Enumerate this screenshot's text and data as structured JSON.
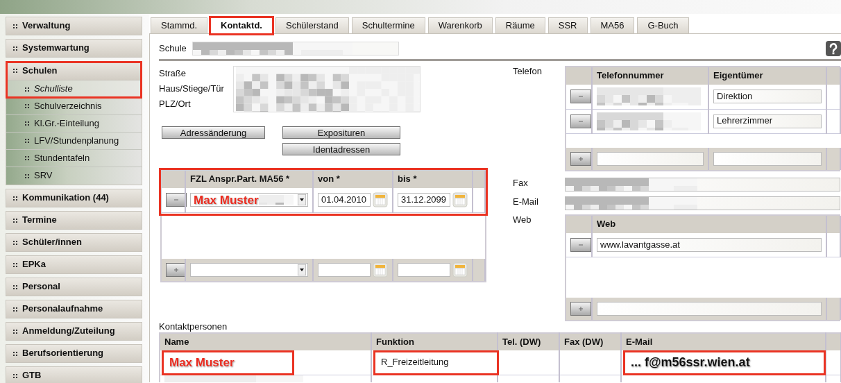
{
  "sidebar": {
    "items": [
      {
        "label": "Verwaltung"
      },
      {
        "label": "Systemwartung"
      },
      {
        "label": "Schulen",
        "highlighted": true,
        "children": [
          {
            "label": "Schulliste",
            "selected": true,
            "highlighted": true
          },
          {
            "label": "Schulverzeichnis",
            "selected": false,
            "highlighted": false
          },
          {
            "label": "Kl.Gr.-Einteilung",
            "selected": false,
            "highlighted": false
          },
          {
            "label": "LFV/Stundenplanung",
            "selected": false,
            "highlighted": false
          },
          {
            "label": "Stundentafeln",
            "selected": false,
            "highlighted": false
          },
          {
            "label": "SRV",
            "selected": false,
            "highlighted": false
          }
        ]
      },
      {
        "label": "Kommunikation (44)"
      },
      {
        "label": "Termine"
      },
      {
        "label": "Schüler/innen"
      },
      {
        "label": "EPKa"
      },
      {
        "label": "Personal"
      },
      {
        "label": "Personalaufnahme"
      },
      {
        "label": "Anmeldung/Zuteilung"
      },
      {
        "label": "Berufsorientierung"
      },
      {
        "label": "GTB"
      }
    ]
  },
  "tabs": [
    {
      "label": "Stammd.",
      "selected": false,
      "highlighted": false
    },
    {
      "label": "Kontaktd.",
      "selected": true,
      "highlighted": true
    },
    {
      "label": "Schülerstand",
      "selected": false,
      "highlighted": false
    },
    {
      "label": "Schultermine",
      "selected": false,
      "highlighted": false
    },
    {
      "label": "Warenkorb",
      "selected": false,
      "highlighted": false
    },
    {
      "label": "Räume",
      "selected": false,
      "highlighted": false
    },
    {
      "label": "SSR",
      "selected": false,
      "highlighted": false
    },
    {
      "label": "MA56",
      "selected": false,
      "highlighted": false
    },
    {
      "label": "G-Buch",
      "selected": false,
      "highlighted": false
    }
  ],
  "school": {
    "label": "Schule",
    "redacted": true
  },
  "address": {
    "labels": [
      "Straße",
      "Haus/Stiege/Tür",
      "PLZ/Ort"
    ],
    "redacted": true
  },
  "buttons": [
    "Adressänderung",
    "Exposituren",
    "Identadressen"
  ],
  "contact_partner": {
    "highlighted": true,
    "columns": [
      "FZL Anspr.Part. MA56 *",
      "von *",
      "bis *"
    ],
    "rows": [
      {
        "name": "Max Muster",
        "from": "01.04.2010",
        "to": "31.12.2099",
        "redacted": true
      }
    ]
  },
  "phone": {
    "label": "Telefon",
    "columns": [
      "Telefonnummer",
      "Eigentümer"
    ],
    "rows": [
      {
        "owner": "Direktion",
        "redacted": true
      },
      {
        "owner": "Lehrerzimmer",
        "redacted": true
      }
    ]
  },
  "fax": {
    "label": "Fax",
    "redacted": true
  },
  "email": {
    "label": "E-Mail",
    "redacted": true
  },
  "web": {
    "label": "Web",
    "columns": [
      "Web"
    ],
    "rows": [
      {
        "url": "www.lavantgasse.at"
      }
    ]
  },
  "contacts": {
    "title": "Kontaktpersonen",
    "columns": [
      "Name",
      "Funktion",
      "Tel. (DW)",
      "Fax (DW)",
      "E-Mail"
    ],
    "rows": [
      {
        "cells": [
          {
            "text": "Max Muster",
            "kind": "annotation",
            "highlighted": true
          },
          {
            "text": "R_Freizeitleitung",
            "kind": "plain",
            "highlighted": true
          },
          {
            "text": "",
            "kind": "plain",
            "highlighted": false
          },
          {
            "text": "",
            "kind": "plain",
            "highlighted": false
          },
          {
            "text": "... f@m56ssr.wien.at",
            "kind": "emphasis",
            "highlighted": true
          }
        ]
      }
    ],
    "more_rows_redacted": true
  }
}
